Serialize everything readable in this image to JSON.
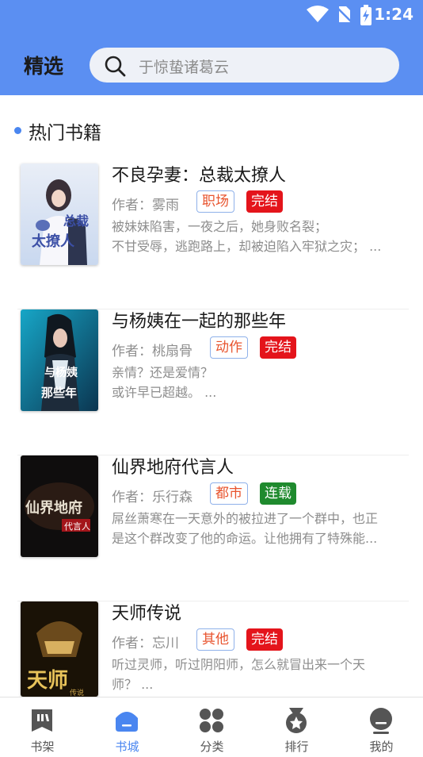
{
  "status_bar": {
    "time": "1:24",
    "icons": [
      "wifi-icon",
      "no-sim-icon",
      "battery-charging-icon"
    ]
  },
  "header": {
    "title": "精选",
    "search_placeholder": "于惊蛰诸葛云"
  },
  "section": {
    "title": "热门书籍"
  },
  "books": [
    {
      "title": "不良孕妻：总裁太撩人",
      "author": "作者：雾雨",
      "category": "职场",
      "status": "完结",
      "status_color": "#e4141b",
      "desc": [
        "被妹妹陷害，一夜之后，她身败名裂；",
        "不甘受辱，逃跑路上，却被迫陷入牢狱之灾； ..."
      ]
    },
    {
      "title": "与杨姨在一起的那些年",
      "author": "作者：桃扇骨",
      "category": "动作",
      "status": "完结",
      "status_color": "#e4141b",
      "desc": [
        "亲情？还是爱情？",
        "或许早已超越。 ..."
      ]
    },
    {
      "title": "仙界地府代言人",
      "author": "作者：乐行森",
      "category": "都市",
      "status": "连载",
      "status_color": "#1f8a2e",
      "desc": [
        "屌丝萧寒在一天意外的被拉进了一个群中，也正",
        "是这个群改变了他的命运。让他拥有了特殊能..."
      ]
    },
    {
      "title": "天师传说",
      "author": "作者：忘川",
      "category": "其他",
      "status": "完结",
      "status_color": "#e4141b",
      "desc": [
        "听过灵师，听过阴阳师，怎么就冒出来一个天",
        "师？ ..."
      ]
    }
  ],
  "tabs": [
    {
      "label": "书架",
      "icon": "bookshelf-icon"
    },
    {
      "label": "书城",
      "icon": "bookstore-icon",
      "active": true
    },
    {
      "label": "分类",
      "icon": "category-icon"
    },
    {
      "label": "排行",
      "icon": "ranking-medal-icon"
    },
    {
      "label": "我的",
      "icon": "profile-icon"
    }
  ],
  "colors": {
    "header_bg": "#5b8ff2",
    "accent": "#4a86f0",
    "tag_text": "#e8542e"
  }
}
